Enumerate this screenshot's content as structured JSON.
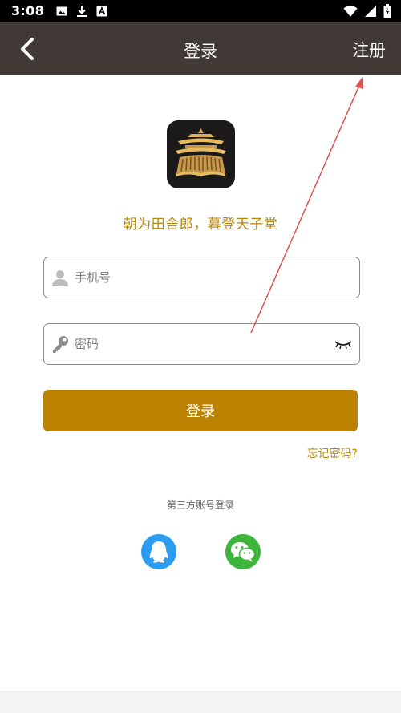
{
  "status_bar": {
    "time": "3:08",
    "left_icons": [
      "image-icon",
      "download-icon",
      "a-icon"
    ],
    "right_icons": [
      "wifi-icon",
      "signal-icon",
      "battery-icon"
    ]
  },
  "nav": {
    "title": "登录",
    "back_icon": "chevron-left-icon",
    "register_label": "注册"
  },
  "slogan": "朝为田舍郎，暮登天子堂",
  "form": {
    "phone_placeholder": "手机号",
    "phone_value": "",
    "password_placeholder": "密码",
    "password_value": "",
    "login_label": "登录",
    "forgot_label": "忘记密码?"
  },
  "third_party": {
    "label": "第三方账号登录",
    "providers": [
      "qq-icon",
      "wechat-icon"
    ]
  },
  "colors": {
    "nav_bg": "#403936",
    "accent": "#bb8300",
    "slogan": "#b8860b",
    "qq": "#2b9cf0",
    "wechat": "#3db43a",
    "annotation_arrow": "#e05050"
  }
}
